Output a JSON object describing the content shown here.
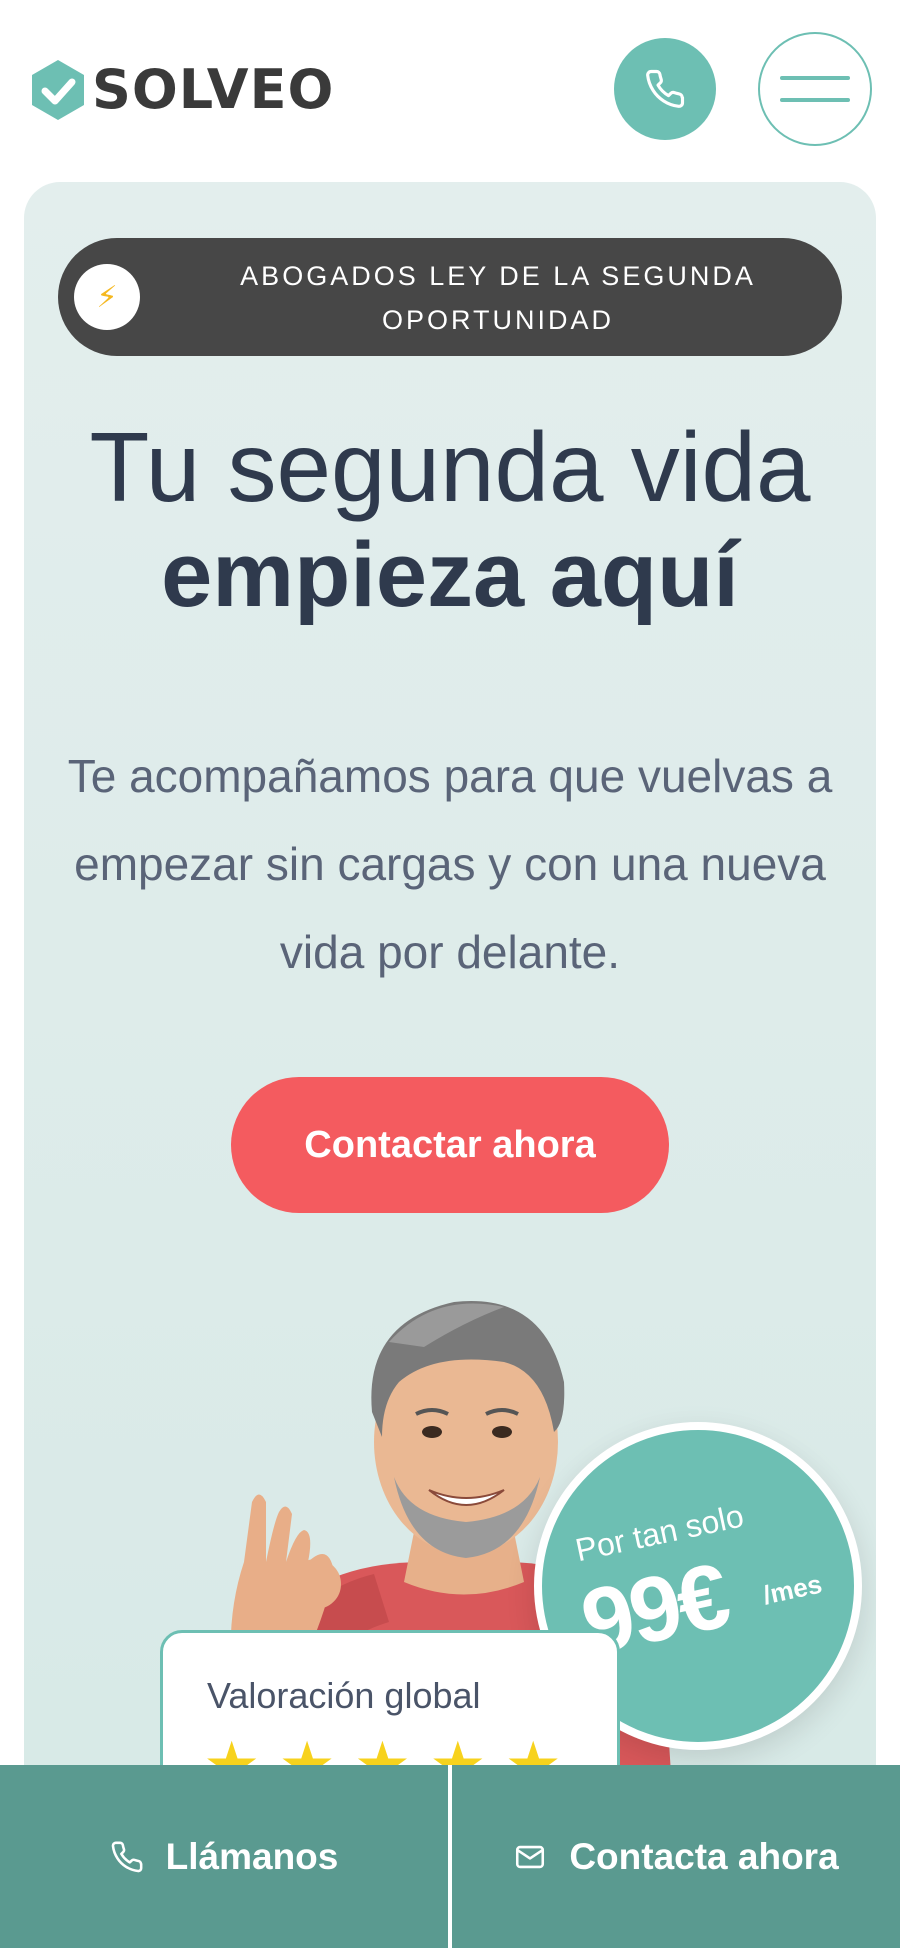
{
  "header": {
    "logo_text": "SOLVEO",
    "call_icon": "phone-icon",
    "menu_icon": "hamburger-icon",
    "colors": {
      "accent": "#6dbfb3",
      "logo_text": "#3a3a3a"
    }
  },
  "hero": {
    "badge_icon": "lightning-icon",
    "badge_text": "ABOGADOS LEY DE LA SEGUNDA OPORTUNIDAD",
    "title_line1": "Tu segunda vida",
    "title_line2": "empieza aquí",
    "subtitle": "Te acompañamos para que vuelvas a empezar sin cargas y con una nueva vida por delante.",
    "cta_label": "Contactar ahora",
    "colors": {
      "background": "#dfecea",
      "badge": "#474747",
      "cta": "#f45b5f",
      "title": "#2f3a4d"
    }
  },
  "price_badge": {
    "prefix": "Por tan solo",
    "amount": "99€",
    "suffix": "/mes"
  },
  "rating_card": {
    "title": "Valoración global",
    "stars": 5
  },
  "bottom_bar": {
    "call_label": "Llámanos",
    "call_icon": "phone-icon",
    "contact_label": "Contacta ahora",
    "contact_icon": "mail-icon",
    "color": "#5a9a90"
  }
}
